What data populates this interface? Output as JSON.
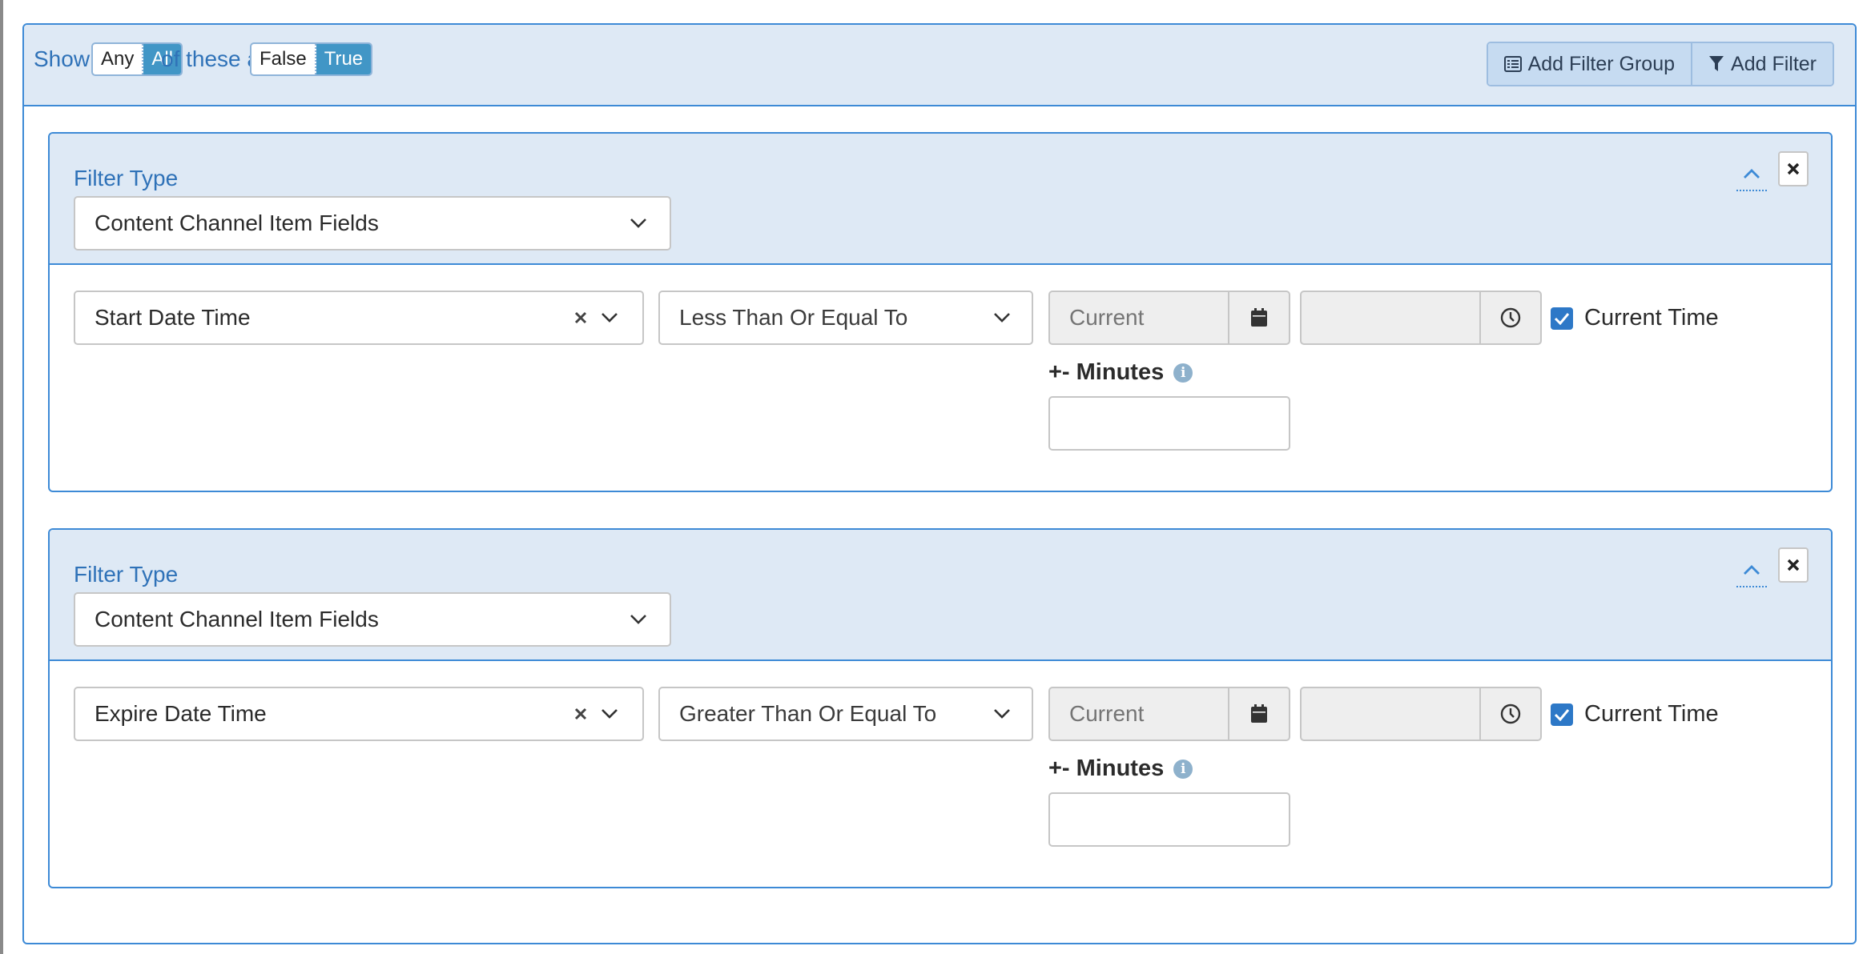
{
  "header": {
    "show_if_label": "Show if",
    "any_label": "Any",
    "all_label": "All",
    "of_these_are_label": "of these are",
    "false_label": "False",
    "true_label": "True",
    "add_filter_group_label": "Add Filter Group",
    "add_filter_label": "Add Filter"
  },
  "filters": [
    {
      "filter_type_label": "Filter Type",
      "filter_type_value": "Content Channel Item Fields",
      "field_value": "Start Date Time",
      "comparison_value": "Less Than Or Equal To",
      "date_placeholder": "Current",
      "time_value": "",
      "current_time_label": "Current Time",
      "current_time_checked": true,
      "minutes_label": "+- Minutes",
      "minutes_value": ""
    },
    {
      "filter_type_label": "Filter Type",
      "filter_type_value": "Content Channel Item Fields",
      "field_value": "Expire Date Time",
      "comparison_value": "Greater Than Or Equal To",
      "date_placeholder": "Current",
      "time_value": "",
      "current_time_label": "Current Time",
      "current_time_checked": true,
      "minutes_label": "+- Minutes",
      "minutes_value": ""
    }
  ],
  "icons": {
    "collapse": "chevron-up-icon",
    "remove": "close-icon",
    "calendar": "calendar-icon",
    "clock": "clock-icon",
    "info": "info-icon",
    "add_filter_group": "list-icon",
    "add_filter": "filter-icon"
  },
  "colors": {
    "accent_blue": "#3d8ad6",
    "header_bg": "#dee9f5",
    "toggle_active": "#4196c6",
    "button_bg": "#c6dbf1",
    "checkbox": "#2d78c7",
    "label_blue": "#2f72b8"
  }
}
